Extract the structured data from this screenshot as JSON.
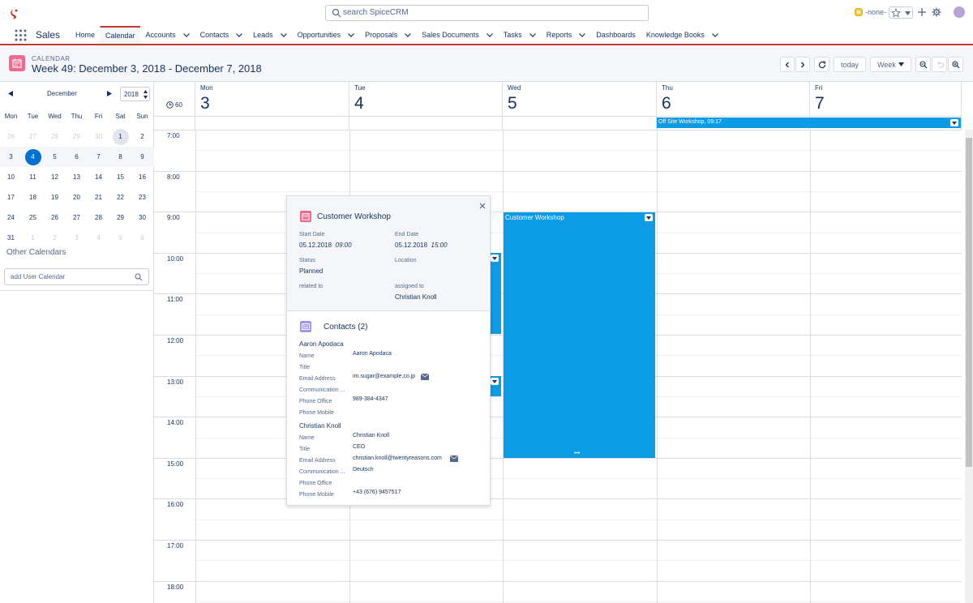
{
  "search": {
    "placeholder": "search SpiceCRM"
  },
  "topright": {
    "none_label": "-none-"
  },
  "app": {
    "name": "Sales"
  },
  "nav": [
    {
      "label": "Home",
      "chev": false
    },
    {
      "label": "Calendar",
      "chev": false,
      "active": true
    },
    {
      "label": "Accounts",
      "chev": true
    },
    {
      "label": "Contacts",
      "chev": true
    },
    {
      "label": "Leads",
      "chev": true
    },
    {
      "label": "Opportunities",
      "chev": true
    },
    {
      "label": "Proposals",
      "chev": true
    },
    {
      "label": "Sales Documents",
      "chev": true
    },
    {
      "label": "Tasks",
      "chev": true
    },
    {
      "label": "Reports",
      "chev": true
    },
    {
      "label": "Dashboards",
      "chev": false
    },
    {
      "label": "Knowledge Books",
      "chev": true
    }
  ],
  "header": {
    "subtitle": "CALENDAR",
    "title": "Week 49: December 3, 2018 - December 7, 2018",
    "today_label": "today",
    "view_label": "Week"
  },
  "mini": {
    "month": "December",
    "year": "2018",
    "weekdays": [
      "Mon",
      "Tue",
      "Wed",
      "Thu",
      "Fri",
      "Sat",
      "Sun"
    ],
    "weeks": [
      [
        "26",
        "27",
        "28",
        "29",
        "30",
        "1",
        "2"
      ],
      [
        "3",
        "4",
        "5",
        "6",
        "7",
        "8",
        "9"
      ],
      [
        "10",
        "11",
        "12",
        "13",
        "14",
        "15",
        "16"
      ],
      [
        "17",
        "18",
        "19",
        "20",
        "21",
        "22",
        "23"
      ],
      [
        "24",
        "25",
        "26",
        "27",
        "28",
        "29",
        "30"
      ],
      [
        "31",
        "1",
        "2",
        "3",
        "4",
        "5",
        "6"
      ]
    ]
  },
  "sidebar": {
    "other_calendars": "Other Calendars",
    "add_placeholder": "add User Calendar"
  },
  "calendar": {
    "slot_label": "60",
    "days": [
      {
        "name": "Mon",
        "num": "3"
      },
      {
        "name": "Tue",
        "num": "4"
      },
      {
        "name": "Wed",
        "num": "5"
      },
      {
        "name": "Thu",
        "num": "6"
      },
      {
        "name": "Fri",
        "num": "7"
      }
    ],
    "hours": [
      "7:00",
      "8:00",
      "9:00",
      "10:00",
      "11:00",
      "12:00",
      "13:00",
      "14:00",
      "15:00",
      "16:00",
      "17:00",
      "18:00"
    ],
    "allday_event": "Off Site Workshop, 09:17",
    "wed_event": "Customer Workshop",
    "wed_more": "•••"
  },
  "popover": {
    "title": "Customer Workshop",
    "start_label": "Start Date",
    "start_date": "05.12.2018",
    "start_time": "09:00",
    "end_label": "End Date",
    "end_date": "05.12.2018",
    "end_time": "15:00",
    "status_label": "Status",
    "status_value": "Planned",
    "location_label": "Location",
    "related_label": "related to",
    "assigned_label": "assigned to",
    "assigned_value": "Christian Knoll",
    "contacts_title": "Contacts (2)",
    "contacts": [
      {
        "heading": "Aaron Apodaca",
        "rows": [
          {
            "label": "Name",
            "value": "Aaron Apodaca"
          },
          {
            "label": "Title",
            "value": ""
          },
          {
            "label": "Email Address",
            "value": "im.sugar@example.co.jp",
            "mail": true
          },
          {
            "label": "Communication ...",
            "value": ""
          },
          {
            "label": "Phone Office",
            "value": "989-384-4347"
          },
          {
            "label": "Phone Mobile",
            "value": ""
          }
        ]
      },
      {
        "heading": "Christian Knoll",
        "rows": [
          {
            "label": "Name",
            "value": "Christian Knoll"
          },
          {
            "label": "Title",
            "value": "CEO"
          },
          {
            "label": "Email Address",
            "value": "christian.knoll@twentyreasons.com",
            "mail": true
          },
          {
            "label": "Communication ...",
            "value": "Deutsch"
          },
          {
            "label": "Phone Office",
            "value": ""
          },
          {
            "label": "Phone Mobile",
            "value": "+43 (676) 9457517"
          }
        ]
      }
    ]
  }
}
